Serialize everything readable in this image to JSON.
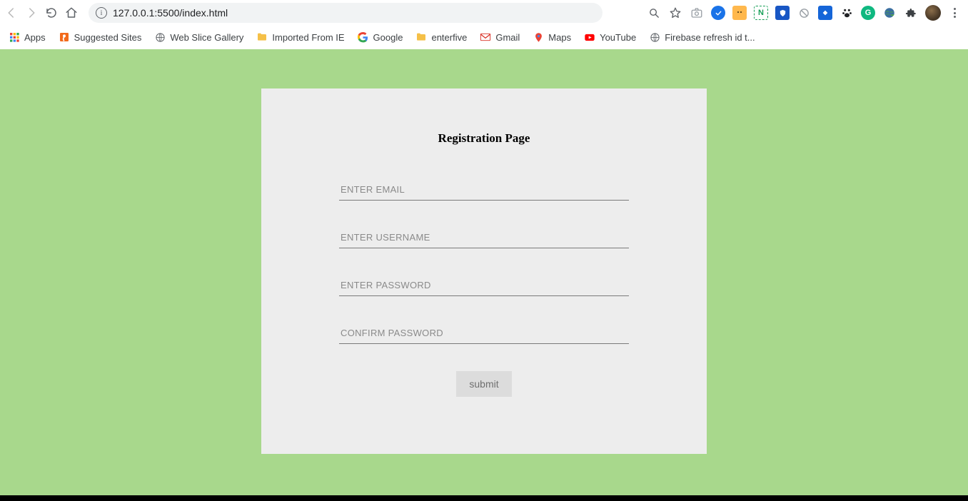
{
  "browser": {
    "url": "127.0.0.1:5500/index.html"
  },
  "bookmarks": {
    "apps": "Apps",
    "suggested": "Suggested Sites",
    "webslice": "Web Slice Gallery",
    "imported": "Imported From IE",
    "google": "Google",
    "enterfive": "enterfive",
    "gmail": "Gmail",
    "maps": "Maps",
    "youtube": "YouTube",
    "firebase": "Firebase refresh id t..."
  },
  "form": {
    "title": "Registration Page",
    "email_placeholder": "ENTER EMAIL",
    "username_placeholder": "ENTER USERNAME",
    "password_placeholder": "ENTER PASSWORD",
    "confirm_placeholder": "CONFIRM PASSWORD",
    "submit_label": "submit"
  }
}
